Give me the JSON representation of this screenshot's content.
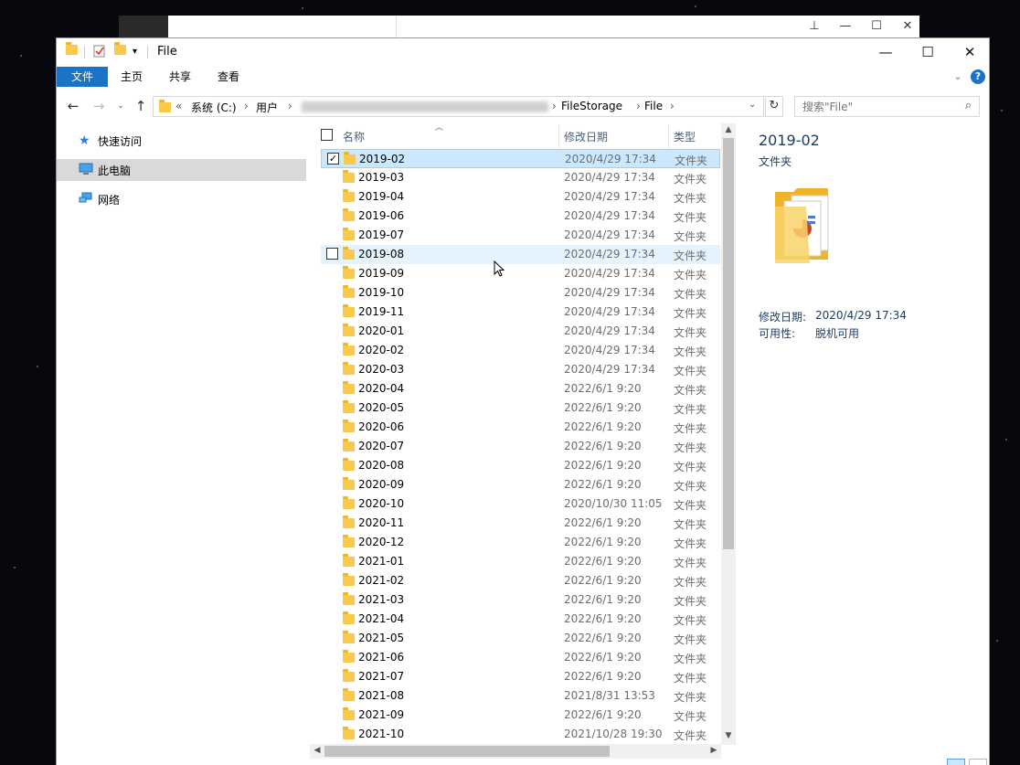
{
  "window": {
    "title": "File"
  },
  "ribbon": {
    "tabs": [
      "文件",
      "主页",
      "共享",
      "查看"
    ]
  },
  "address": {
    "prefix": "«",
    "segments": [
      "系统 (C:)",
      "用户",
      "FileStorage",
      "File"
    ]
  },
  "search": {
    "placeholder": "搜索\"File\""
  },
  "nav": {
    "items": [
      {
        "label": "快速访问",
        "icon": "star-icon"
      },
      {
        "label": "此电脑",
        "icon": "computer-icon"
      },
      {
        "label": "网络",
        "icon": "network-icon"
      }
    ]
  },
  "columns": {
    "name": "名称",
    "date": "修改日期",
    "type": "类型"
  },
  "files": [
    {
      "name": "2019-02",
      "date": "2020/4/29 17:34",
      "type": "文件夹"
    },
    {
      "name": "2019-03",
      "date": "2020/4/29 17:34",
      "type": "文件夹"
    },
    {
      "name": "2019-04",
      "date": "2020/4/29 17:34",
      "type": "文件夹"
    },
    {
      "name": "2019-06",
      "date": "2020/4/29 17:34",
      "type": "文件夹"
    },
    {
      "name": "2019-07",
      "date": "2020/4/29 17:34",
      "type": "文件夹"
    },
    {
      "name": "2019-08",
      "date": "2020/4/29 17:34",
      "type": "文件夹"
    },
    {
      "name": "2019-09",
      "date": "2020/4/29 17:34",
      "type": "文件夹"
    },
    {
      "name": "2019-10",
      "date": "2020/4/29 17:34",
      "type": "文件夹"
    },
    {
      "name": "2019-11",
      "date": "2020/4/29 17:34",
      "type": "文件夹"
    },
    {
      "name": "2020-01",
      "date": "2020/4/29 17:34",
      "type": "文件夹"
    },
    {
      "name": "2020-02",
      "date": "2020/4/29 17:34",
      "type": "文件夹"
    },
    {
      "name": "2020-03",
      "date": "2020/4/29 17:34",
      "type": "文件夹"
    },
    {
      "name": "2020-04",
      "date": "2022/6/1 9:20",
      "type": "文件夹"
    },
    {
      "name": "2020-05",
      "date": "2022/6/1 9:20",
      "type": "文件夹"
    },
    {
      "name": "2020-06",
      "date": "2022/6/1 9:20",
      "type": "文件夹"
    },
    {
      "name": "2020-07",
      "date": "2022/6/1 9:20",
      "type": "文件夹"
    },
    {
      "name": "2020-08",
      "date": "2022/6/1 9:20",
      "type": "文件夹"
    },
    {
      "name": "2020-09",
      "date": "2022/6/1 9:20",
      "type": "文件夹"
    },
    {
      "name": "2020-10",
      "date": "2020/10/30 11:05",
      "type": "文件夹"
    },
    {
      "name": "2020-11",
      "date": "2022/6/1 9:20",
      "type": "文件夹"
    },
    {
      "name": "2020-12",
      "date": "2022/6/1 9:20",
      "type": "文件夹"
    },
    {
      "name": "2021-01",
      "date": "2022/6/1 9:20",
      "type": "文件夹"
    },
    {
      "name": "2021-02",
      "date": "2022/6/1 9:20",
      "type": "文件夹"
    },
    {
      "name": "2021-03",
      "date": "2022/6/1 9:20",
      "type": "文件夹"
    },
    {
      "name": "2021-04",
      "date": "2022/6/1 9:20",
      "type": "文件夹"
    },
    {
      "name": "2021-05",
      "date": "2022/6/1 9:20",
      "type": "文件夹"
    },
    {
      "name": "2021-06",
      "date": "2022/6/1 9:20",
      "type": "文件夹"
    },
    {
      "name": "2021-07",
      "date": "2022/6/1 9:20",
      "type": "文件夹"
    },
    {
      "name": "2021-08",
      "date": "2021/8/31 13:53",
      "type": "文件夹"
    },
    {
      "name": "2021-09",
      "date": "2022/6/1 9:20",
      "type": "文件夹"
    },
    {
      "name": "2021-10",
      "date": "2021/10/28 19:30",
      "type": "文件夹"
    }
  ],
  "preview": {
    "title": "2019-02",
    "type": "文件夹",
    "modified_label": "修改日期:",
    "modified_value": "2020/4/29 17:34",
    "availability_label": "可用性:",
    "availability_value": "脱机可用"
  },
  "colors": {
    "accent": "#1a73c8",
    "selection": "#cce8ff",
    "hover": "#e5f3ff",
    "folder": "#f8c94b"
  }
}
